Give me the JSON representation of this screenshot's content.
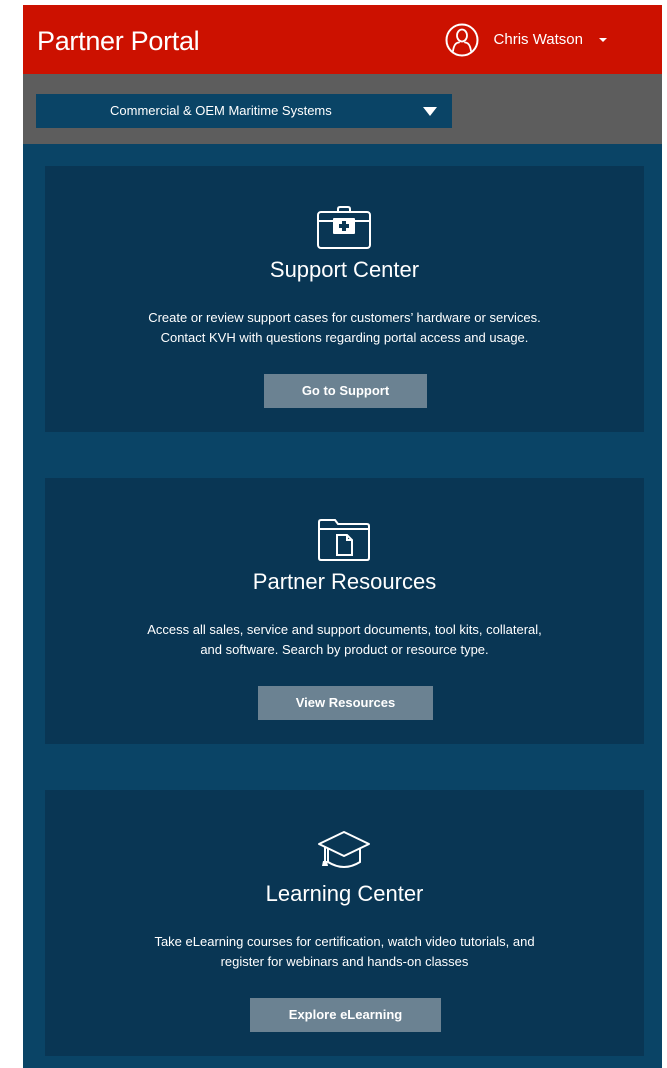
{
  "header": {
    "title": "Partner Portal",
    "user_name": "Chris Watson"
  },
  "business_unit_select": {
    "selected": "Commercial & OEM Maritime Systems"
  },
  "cards": [
    {
      "icon": "first-aid-kit-icon",
      "title": "Support Center",
      "description_lines": [
        "Create or review support cases for customers’ hardware or services.",
        "Contact KVH with questions regarding portal access and usage."
      ],
      "button_label": "Go to Support"
    },
    {
      "icon": "document-folder-icon",
      "title": "Partner Resources",
      "description_lines": [
        "Access all sales, service and support documents, tool kits, collateral,",
        "and software. Search by product or resource type."
      ],
      "button_label": "View Resources"
    },
    {
      "icon": "graduation-cap-icon",
      "title": "Learning Center",
      "description_lines": [
        "Take eLearning courses for certification, watch video tutorials, and",
        "register for webinars and hands-on classes"
      ],
      "button_label": "Explore eLearning"
    }
  ],
  "colors": {
    "header_red": "#cc1100",
    "subbar_gray": "#5d5d5d",
    "page_navy": "#0a4466",
    "card_navy": "#093654",
    "button_slate": "#6b8292"
  }
}
